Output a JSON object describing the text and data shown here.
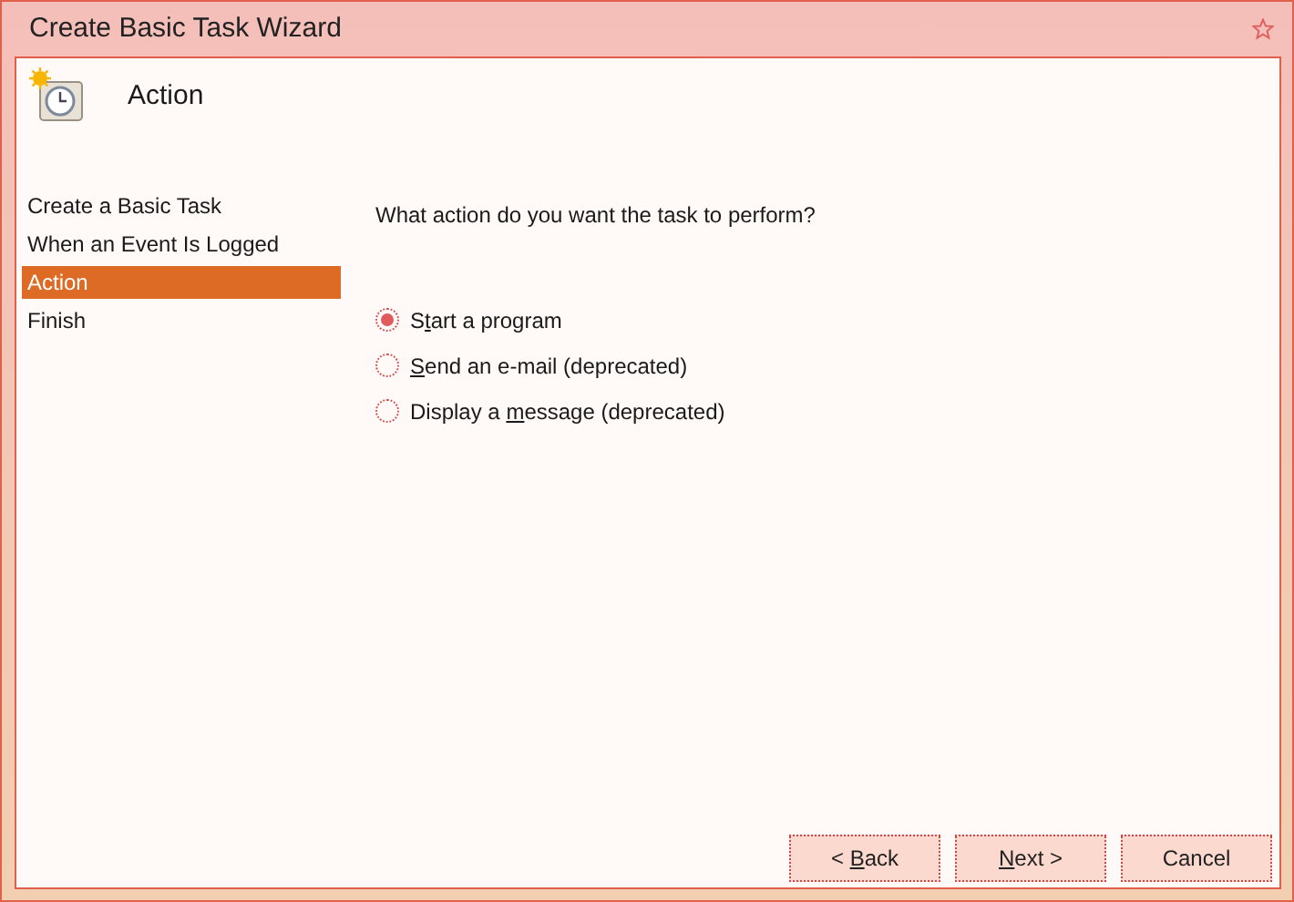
{
  "window": {
    "title": "Create Basic Task Wizard"
  },
  "header": {
    "title": "Action"
  },
  "steps": [
    {
      "label": "Create a Basic Task",
      "selected": false
    },
    {
      "label": "When an Event Is Logged",
      "selected": false
    },
    {
      "label": "Action",
      "selected": true
    },
    {
      "label": "Finish",
      "selected": false
    }
  ],
  "question": "What action do you want the task to perform?",
  "options": [
    {
      "label": {
        "before": "S",
        "access_key": "t",
        "after": "art a program"
      },
      "selected": true
    },
    {
      "label": {
        "access_key": "S",
        "after": "end an e-mail (deprecated)"
      },
      "selected": false
    },
    {
      "label": {
        "before": "Display a ",
        "access_key": "m",
        "after": "essage (deprecated)"
      },
      "selected": false
    }
  ],
  "buttons": [
    {
      "label": {
        "before": "< ",
        "access_key": "B",
        "after": "ack"
      }
    },
    {
      "label": {
        "access_key": "N",
        "after": "ext >"
      }
    },
    {
      "label": {
        "before": "Cancel"
      }
    }
  ]
}
